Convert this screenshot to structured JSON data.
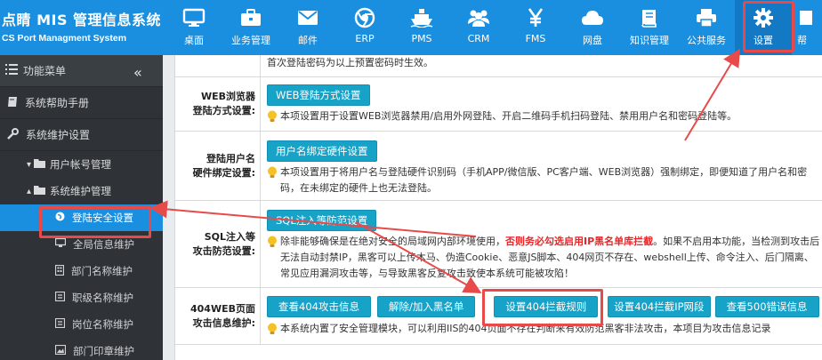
{
  "brand": {
    "title": "点睛 MIS 管理信息系统",
    "subtitle": "CS Port Managment System"
  },
  "nav": [
    {
      "label": "桌面",
      "icon": "monitor-icon"
    },
    {
      "label": "业务管理",
      "icon": "briefcase-icon"
    },
    {
      "label": "邮件",
      "icon": "envelope-icon"
    },
    {
      "label": "ERP",
      "icon": "chrome-icon"
    },
    {
      "label": "PMS",
      "icon": "ship-icon"
    },
    {
      "label": "CRM",
      "icon": "users-icon"
    },
    {
      "label": "FMS",
      "icon": "yen-icon"
    },
    {
      "label": "网盘",
      "icon": "cloud-icon"
    },
    {
      "label": "知识管理",
      "icon": "book-icon"
    },
    {
      "label": "公共服务",
      "icon": "printer-icon"
    },
    {
      "label": "设置",
      "icon": "gear-icon"
    },
    {
      "label": "帮",
      "icon": "help-icon"
    }
  ],
  "sidebar": {
    "header": "功能菜单",
    "collapse": "«",
    "items": [
      {
        "label": "系统帮助手册"
      },
      {
        "label": "系统维护设置"
      }
    ],
    "groups": [
      {
        "label": "用户帐号管理",
        "arrow": "▾"
      },
      {
        "label": "系统维护管理",
        "arrow": "▴"
      }
    ],
    "leaves": [
      {
        "label": "登陆安全设置",
        "active": true
      },
      {
        "label": "全局信息维护"
      },
      {
        "label": "部门名称维护"
      },
      {
        "label": "职级名称维护"
      },
      {
        "label": "岗位名称维护"
      },
      {
        "label": "部门印章维护"
      }
    ]
  },
  "content": {
    "top_note": "首次登陆密码为以上预置密码时生效。",
    "rows": [
      {
        "label_line1": "WEB浏览器",
        "label_line2": "登陆方式设置:",
        "button": "WEB登陆方式设置",
        "note": "本项设置用于设置WEB浏览器禁用/启用外网登陆、开启二维码手机扫码登陆、禁用用户名和密码登陆等。"
      },
      {
        "label_line1": "登陆用户名",
        "label_line2": "硬件绑定设置:",
        "button": "用户名绑定硬件设置",
        "note": "本项设置用于将用户名与登陆硬件识别码（手机APP/微信版、PC客户端、WEB浏览器）强制绑定，即便知道了用户名和密码，在未绑定的硬件上也无法登陆。"
      },
      {
        "label_line1": "SQL注入等",
        "label_line2": "攻击防范设置:",
        "button": "SQL注入等防范设置",
        "note_pre": "除非能够确保是在绝对安全的局域网内部环境使用，",
        "note_red": "否则务必勾选启用IP黑名单库拦截",
        "note_post": "。如果不启用本功能，当检测到攻击后无法自动封禁IP，黑客可以上传木马、伪造Cookie、恶意JS脚本、404网页不存在、webshell上传、命令注入、后门隔离、常见应用漏洞攻击等，与导致黑客反复攻击致使本系统可能被攻陷！"
      },
      {
        "label_line1": "404WEB页面",
        "label_line2": "攻击信息维护:",
        "buttons": [
          "查看404攻击信息",
          "解除/加入黑名单",
          "设置404拦截规则",
          "设置404拦截IP网段",
          "查看500错误信息"
        ],
        "note": "本系统内置了安全管理模块，可以利用IIS的404页面不存在判断来有效防范黑客非法攻击，本项目为攻击信息记录"
      }
    ]
  },
  "colors": {
    "topbar": "#1a8fe0",
    "sidebar": "#2f3337",
    "button": "#17a2c8",
    "highlight": "#e84a4a"
  }
}
